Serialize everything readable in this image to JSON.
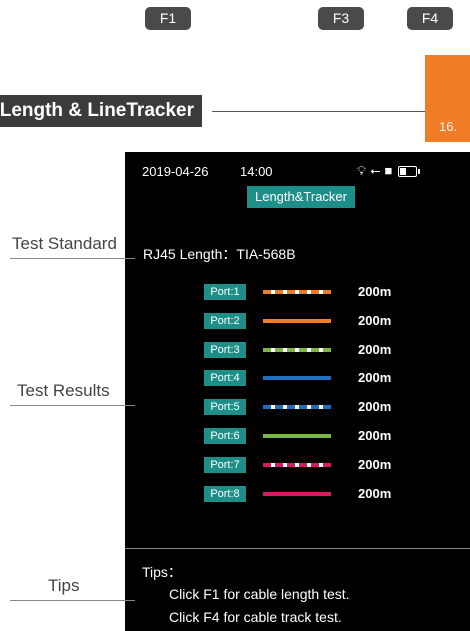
{
  "function_keys": {
    "f1": "F1",
    "f3": "F3",
    "f4": "F4"
  },
  "page_number": "16.",
  "section_title": "Length & LineTracker",
  "device": {
    "date": "2019-04-26",
    "time": "14:00",
    "screen_title": "Length&Tracker",
    "standard": "RJ45 Length：TIA-568B",
    "status_icons": [
      "flashlight-icon",
      "usb-icon",
      "sd-card-icon",
      "battery-icon"
    ],
    "ports": [
      {
        "label": "Port:1",
        "value": "200m",
        "color": "#f07d26",
        "striped": true
      },
      {
        "label": "Port:2",
        "value": "200m",
        "color": "#f07d26",
        "striped": false
      },
      {
        "label": "Port:3",
        "value": "200m",
        "color": "#7ab648",
        "striped": true
      },
      {
        "label": "Port:4",
        "value": "200m",
        "color": "#1e6fc0",
        "striped": false
      },
      {
        "label": "Port:5",
        "value": "200m",
        "color": "#1e6fc0",
        "striped": true
      },
      {
        "label": "Port:6",
        "value": "200m",
        "color": "#7ab648",
        "striped": false
      },
      {
        "label": "Port:7",
        "value": "200m",
        "color": "#d81b60",
        "striped": true
      },
      {
        "label": "Port:8",
        "value": "200m",
        "color": "#d81b60",
        "striped": false
      }
    ],
    "tips_header": "Tips：",
    "tips": [
      "Click F1 for cable length test.",
      "Click F4 for cable track test."
    ]
  },
  "callouts": {
    "test_standard": "Test Standard",
    "test_results": "Test Results",
    "tips": "Tips"
  },
  "colors": {
    "accent": "#1e8f88",
    "orange": "#f07d26"
  }
}
